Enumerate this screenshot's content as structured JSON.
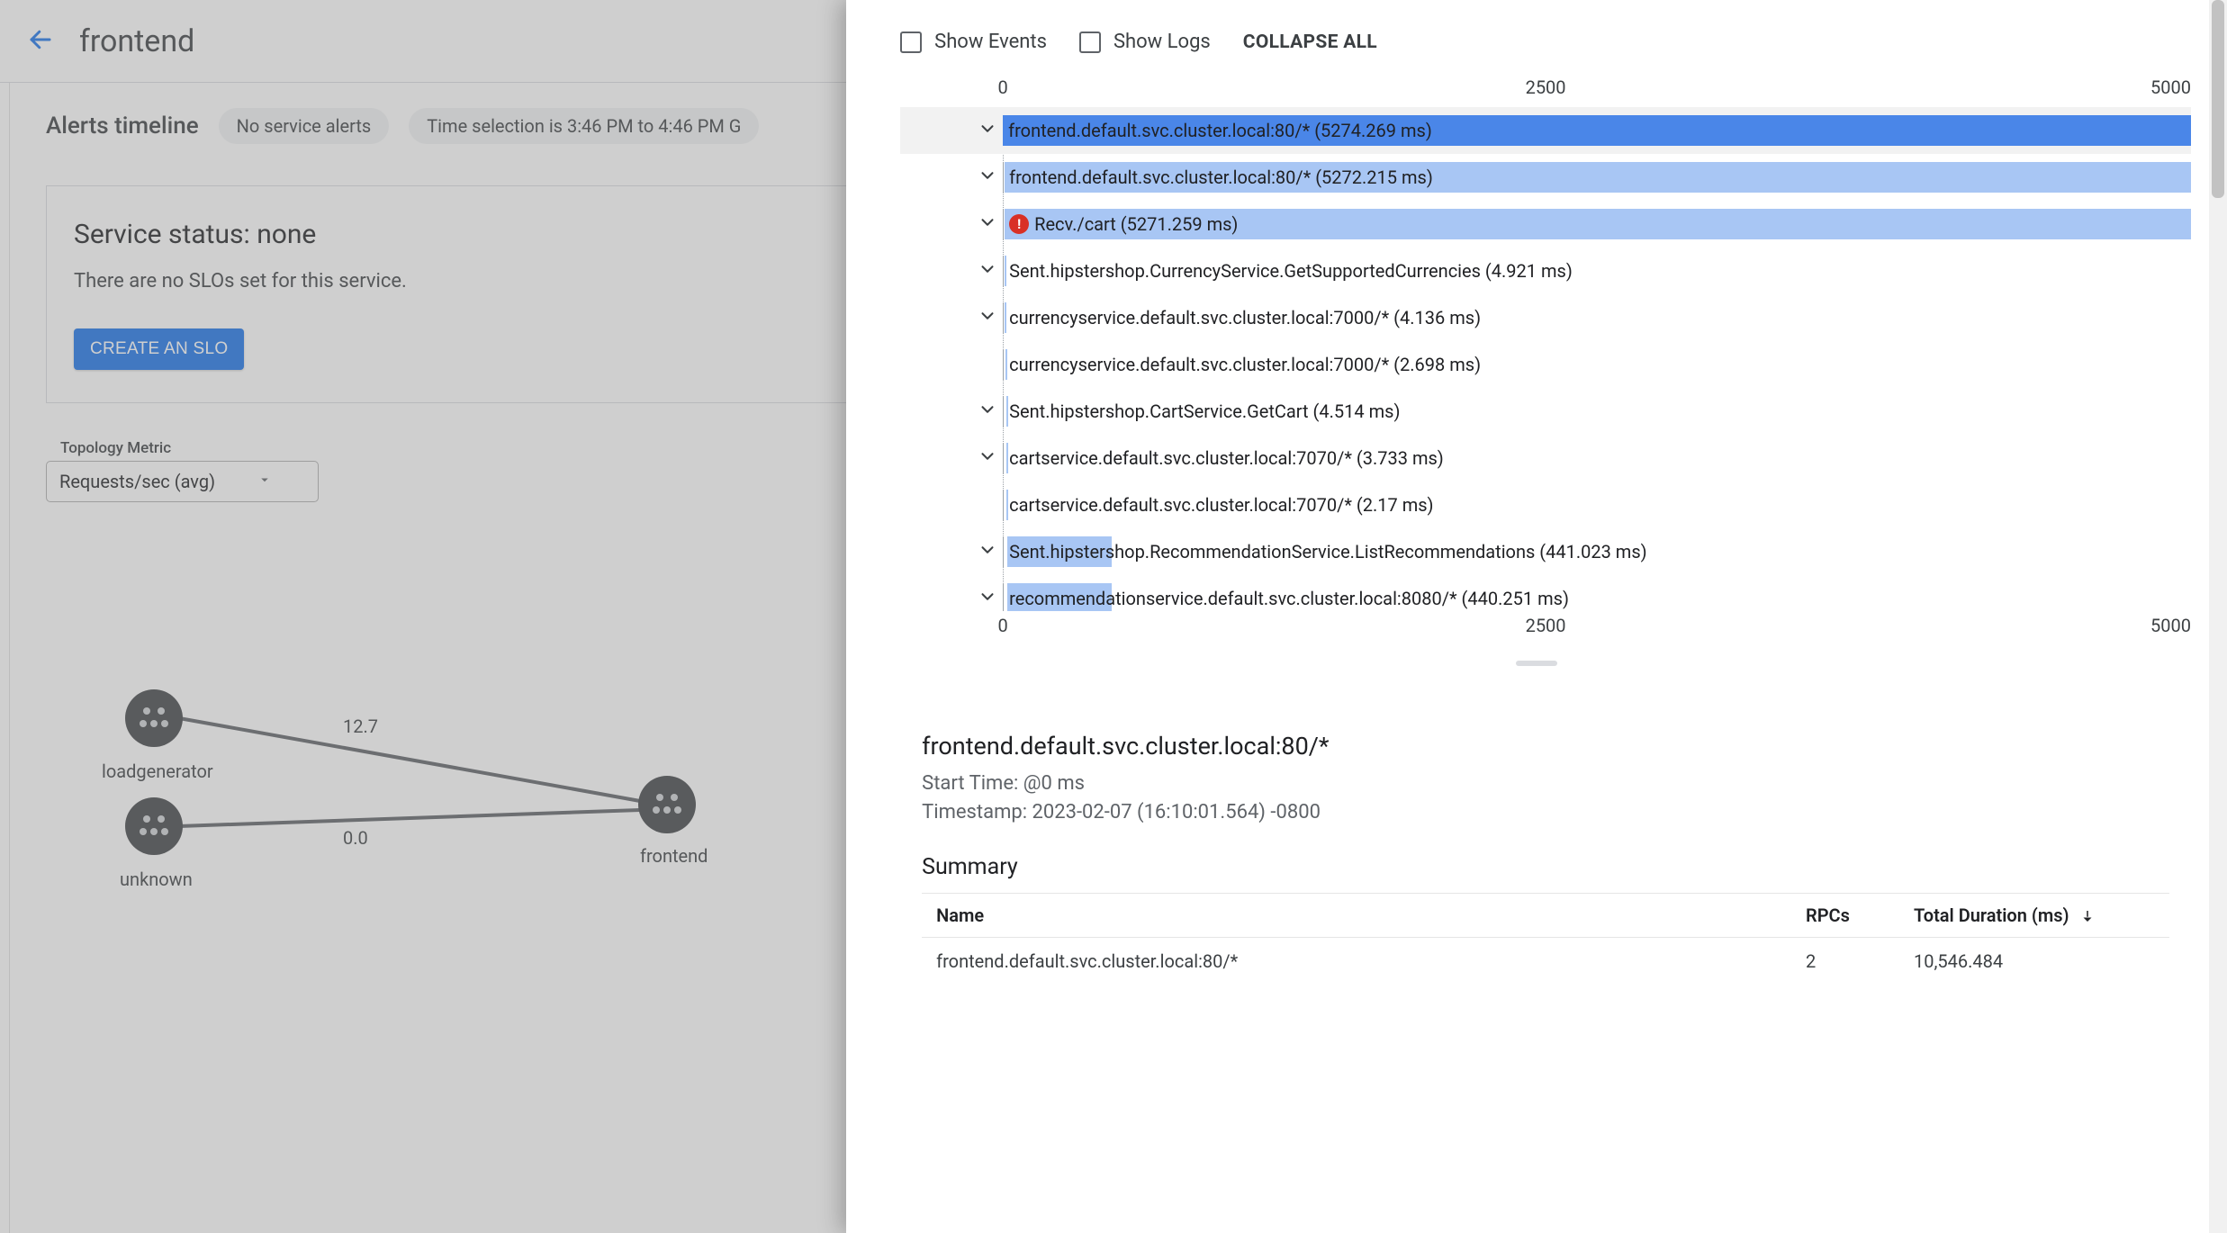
{
  "header": {
    "title": "frontend"
  },
  "alerts": {
    "heading": "Alerts timeline",
    "no_alerts_chip": "No service alerts",
    "time_chip": "Time selection is 3:46 PM to 4:46 PM G"
  },
  "status_card": {
    "title": "Service status: none",
    "body": "There are no SLOs set for this service.",
    "button": "CREATE AN SLO"
  },
  "topology": {
    "label": "Topology Metric",
    "selected": "Requests/sec (avg)",
    "nodes": [
      {
        "id": "loadgenerator",
        "label": "loadgenerator"
      },
      {
        "id": "unknown",
        "label": "unknown"
      },
      {
        "id": "frontend",
        "label": "frontend"
      }
    ],
    "edges": [
      {
        "from": "loadgenerator",
        "to": "frontend",
        "label": "12.7"
      },
      {
        "from": "unknown",
        "to": "frontend",
        "label": "0.0"
      }
    ]
  },
  "trace": {
    "controls": {
      "show_events": "Show Events",
      "show_logs": "Show Logs",
      "collapse_all": "COLLAPSE ALL"
    },
    "axis": {
      "min": 0,
      "mid": 2500,
      "max": 5000
    },
    "sel_index": 0,
    "spans": [
      {
        "label": "frontend.default.svc.cluster.local:80/* (5274.269 ms)",
        "start": 0,
        "dur": 5274.269,
        "color": "#4a86e8",
        "chev": true
      },
      {
        "label": "frontend.default.svc.cluster.local:80/* (5272.215 ms)",
        "start": 2,
        "dur": 5272.215,
        "color": "#a8c6f4",
        "chev": true
      },
      {
        "label": "Recv./cart (5271.259 ms)",
        "start": 3,
        "dur": 5271.259,
        "color": "#a8c6f4",
        "chev": true,
        "error": true
      },
      {
        "label": "Sent.hipstershop.CurrencyService.GetSupportedCurrencies (4.921 ms)",
        "start": 4,
        "dur": 4.921,
        "color": "#a8c6f4",
        "chev": true
      },
      {
        "label": "currencyservice.default.svc.cluster.local:7000/* (4.136 ms)",
        "start": 5,
        "dur": 4.136,
        "color": "#a8c6f4",
        "chev": true
      },
      {
        "label": "currencyservice.default.svc.cluster.local:7000/* (2.698 ms)",
        "start": 6,
        "dur": 2.698,
        "color": "#a8c6f4",
        "chev": false
      },
      {
        "label": "Sent.hipstershop.CartService.GetCart (4.514 ms)",
        "start": 10,
        "dur": 4.514,
        "color": "#a8c6f4",
        "chev": true
      },
      {
        "label": "cartservice.default.svc.cluster.local:7070/* (3.733 ms)",
        "start": 11,
        "dur": 3.733,
        "color": "#a8c6f4",
        "chev": true
      },
      {
        "label": "cartservice.default.svc.cluster.local:7070/* (2.17 ms)",
        "start": 12,
        "dur": 2.17,
        "color": "#a8c6f4",
        "chev": false
      },
      {
        "label": "Sent.hipstershop.RecommendationService.ListRecommendations (441.023 ms)",
        "start": 14,
        "dur": 441.023,
        "color": "#a8c6f4",
        "chev": true
      },
      {
        "label": "recommendationservice.default.svc.cluster.local:8080/* (440.251 ms)",
        "start": 15,
        "dur": 440.251,
        "color": "#a8c6f4",
        "chev": true
      }
    ],
    "details": {
      "title": "frontend.default.svc.cluster.local:80/*",
      "start_line": "Start Time: @0 ms",
      "ts_line": "Timestamp: 2023-02-07 (16:10:01.564) -0800",
      "summary_heading": "Summary",
      "columns": {
        "name": "Name",
        "rpcs": "RPCs",
        "dur": "Total Duration (ms)"
      },
      "rows": [
        {
          "name": "frontend.default.svc.cluster.local:80/*",
          "rpcs": "2",
          "dur": "10,546.484"
        }
      ]
    }
  }
}
